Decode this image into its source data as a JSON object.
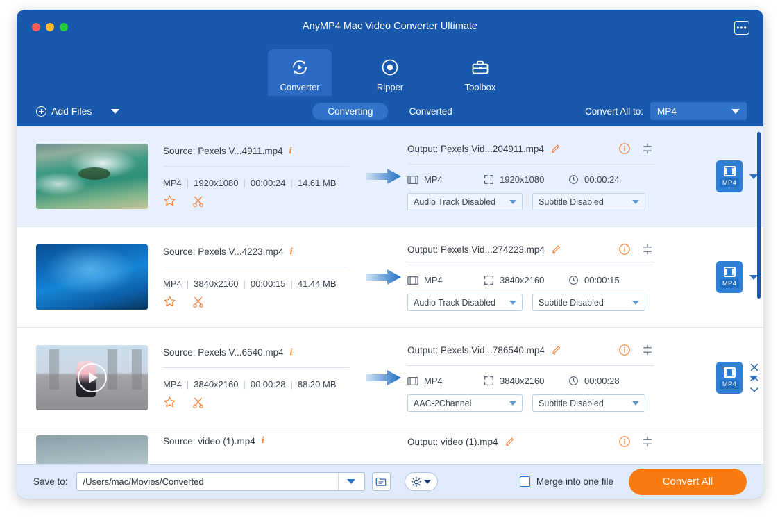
{
  "window": {
    "title": "AnyMP4 Mac Video Converter Ultimate",
    "menu_icon": "menu-dots-icon",
    "traffic_lights": {
      "close": "#ff5f57",
      "minimize": "#febc2e",
      "zoom": "#28c840"
    }
  },
  "nav": {
    "tabs": [
      {
        "label": "Converter",
        "icon": "convert-circular-arrows-icon",
        "active": true
      },
      {
        "label": "Ripper",
        "icon": "disc-record-icon",
        "active": false
      },
      {
        "label": "Toolbox",
        "icon": "toolbox-icon",
        "active": false
      }
    ]
  },
  "toolbar": {
    "add_files_label": "Add Files",
    "add_files_icon": "plus-circle-icon",
    "add_files_caret_icon": "chevron-down-icon",
    "segments": [
      {
        "label": "Converting",
        "active": true
      },
      {
        "label": "Converted",
        "active": false
      }
    ],
    "convert_all_to_label": "Convert All to:",
    "convert_all_to_value": "MP4",
    "convert_all_to_caret_icon": "chevron-down-icon"
  },
  "colors": {
    "header_blue": "#1959ad",
    "accent_orange": "#f97b10",
    "selected_row": "#e7f0fc",
    "badge_blue": "#2f7fd6"
  },
  "rows": [
    {
      "selected": true,
      "thumb_class": "t1",
      "has_play_overlay": false,
      "source_title": "Source: Pexels V...4911.mp4",
      "source_format": "MP4",
      "source_resolution": "1920x1080",
      "source_duration": "00:00:24",
      "source_size": "14.61 MB",
      "output_title": "Output: Pexels Vid...204911.mp4",
      "output_format": "MP4",
      "output_resolution": "1920x1080",
      "output_duration": "00:00:24",
      "audio_track": "Audio Track Disabled",
      "subtitle": "Subtitle Disabled",
      "badge_label": "MP4",
      "show_row_controls": false
    },
    {
      "selected": false,
      "thumb_class": "t2",
      "has_play_overlay": false,
      "source_title": "Source: Pexels V...4223.mp4",
      "source_format": "MP4",
      "source_resolution": "3840x2160",
      "source_duration": "00:00:15",
      "source_size": "41.44 MB",
      "output_title": "Output: Pexels Vid...274223.mp4",
      "output_format": "MP4",
      "output_resolution": "3840x2160",
      "output_duration": "00:00:15",
      "audio_track": "Audio Track Disabled",
      "subtitle": "Subtitle Disabled",
      "badge_label": "MP4",
      "show_row_controls": false
    },
    {
      "selected": false,
      "thumb_class": "t3",
      "has_play_overlay": true,
      "source_title": "Source: Pexels V...6540.mp4",
      "source_format": "MP4",
      "source_resolution": "3840x2160",
      "source_duration": "00:00:28",
      "source_size": "88.20 MB",
      "output_title": "Output: Pexels Vid...786540.mp4",
      "output_format": "MP4",
      "output_resolution": "3840x2160",
      "output_duration": "00:00:28",
      "audio_track": "AAC-2Channel",
      "subtitle": "Subtitle Disabled",
      "badge_label": "MP4",
      "show_row_controls": true,
      "row_controls": [
        "close-icon",
        "chevron-up-icon",
        "chevron-down-icon"
      ]
    }
  ],
  "partial_row": {
    "thumb_class": "t4",
    "source_title": "Source: video (1).mp4",
    "output_title": "Output: video (1).mp4"
  },
  "icons": {
    "info": "info-icon",
    "magic_star": "enhance-star-icon",
    "scissors": "cut-scissors-icon",
    "pencil": "edit-pencil-icon",
    "info_circle": "info-circle-icon",
    "settings_sliders": "settings-sliders-icon",
    "film": "film-strip-icon",
    "expand": "resolution-expand-icon",
    "clock": "clock-icon",
    "arrow": "convert-arrow-icon"
  },
  "bottom": {
    "save_to_label": "Save to:",
    "save_to_path": "/Users/mac/Movies/Converted",
    "save_to_placeholder": "/Users/mac/Movies/Converted",
    "path_caret_icon": "chevron-down-icon",
    "folder_icon": "folder-open-icon",
    "gear_icon": "gear-icon",
    "gear_caret_icon": "chevron-down-icon",
    "merge_label": "Merge into one file",
    "merge_checked": false,
    "convert_all_label": "Convert All"
  },
  "scrollbar": {
    "visible": true
  }
}
